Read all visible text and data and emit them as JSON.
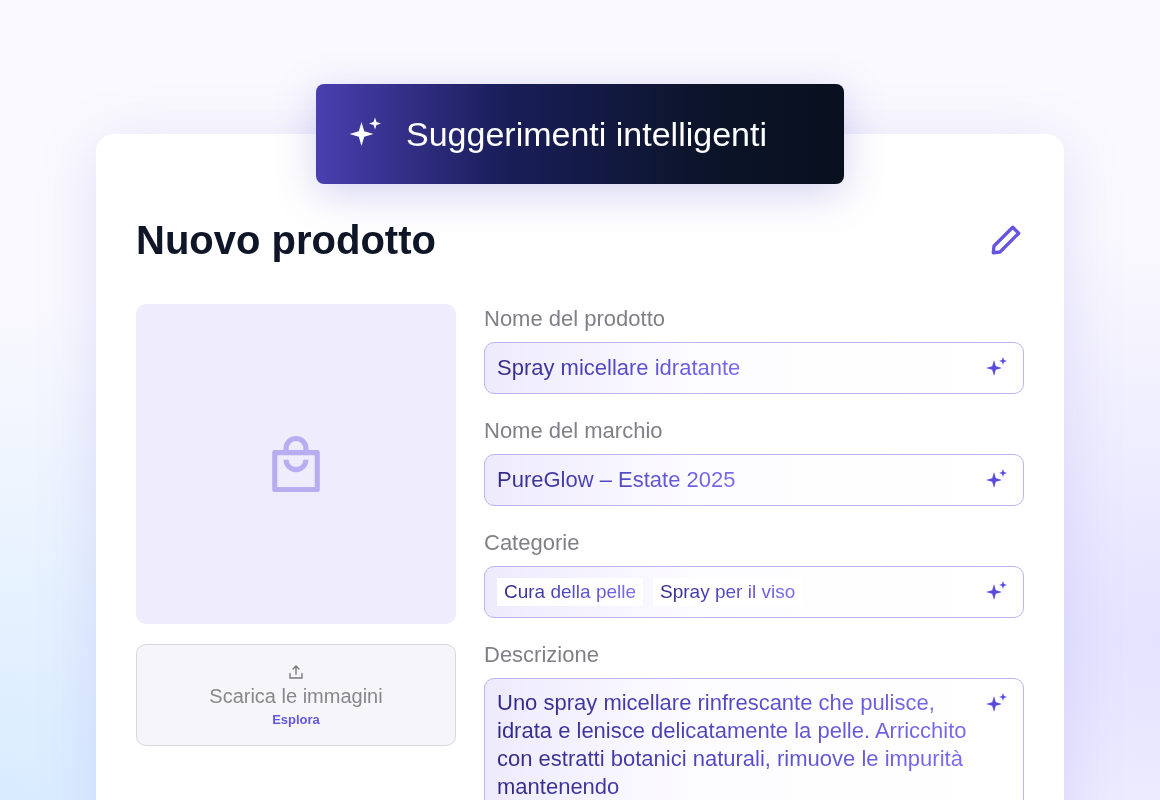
{
  "badge": {
    "label": "Suggerimenti intelligenti"
  },
  "form": {
    "title": "Nuovo prodotto",
    "upload": {
      "label": "Scarica le immagini",
      "link": "Esplora"
    },
    "fields": [
      {
        "kind": "text",
        "label": "Nome del prodotto",
        "value": "Spray micellare idratante"
      },
      {
        "kind": "text",
        "label": "Nome del marchio",
        "value": "PureGlow – Estate 2025"
      },
      {
        "kind": "tags",
        "label": "Categorie",
        "tags": [
          "Cura della pelle",
          "Spray per il viso"
        ]
      },
      {
        "kind": "textarea",
        "label": "Descrizione",
        "value": "Uno spray micellare rinfrescante che pulisce, idrata e lenisce delicatamente la pelle. Arricchito con estratti botanici naturali, rimuove le impurità mantenendo"
      }
    ]
  }
}
